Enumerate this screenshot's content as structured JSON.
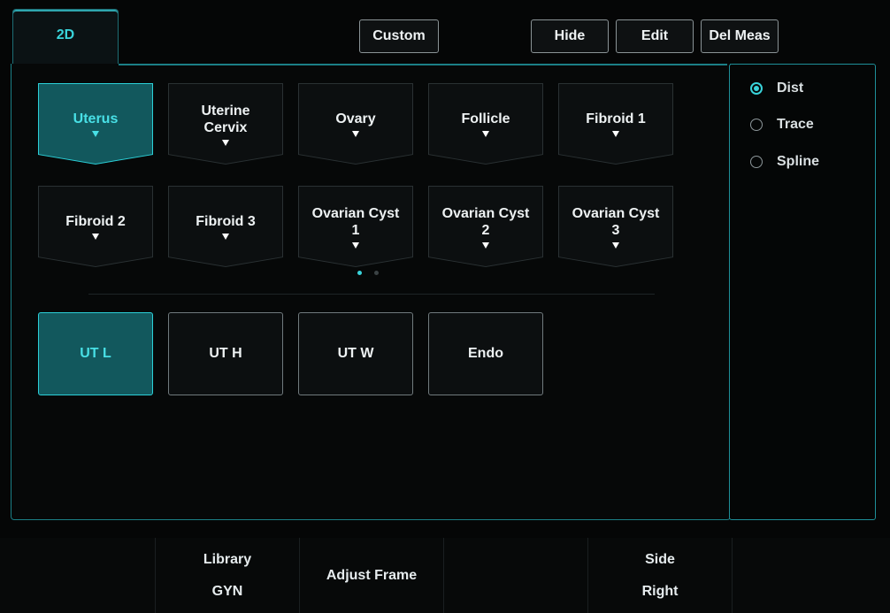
{
  "tab": {
    "label": "2D"
  },
  "toolbar": {
    "custom_label": "Custom",
    "hide_label": "Hide",
    "edit_label": "Edit",
    "del_meas_label": "Del Meas"
  },
  "structures": [
    {
      "label": "Uterus",
      "selected": true
    },
    {
      "label": "Uterine\nCervix",
      "selected": false
    },
    {
      "label": "Ovary",
      "selected": false
    },
    {
      "label": "Follicle",
      "selected": false
    },
    {
      "label": "Fibroid 1",
      "selected": false
    },
    {
      "label": "Fibroid 2",
      "selected": false
    },
    {
      "label": "Fibroid 3",
      "selected": false
    },
    {
      "label": "Ovarian Cyst\n1",
      "selected": false
    },
    {
      "label": "Ovarian Cyst\n2",
      "selected": false
    },
    {
      "label": "Ovarian Cyst\n3",
      "selected": false
    }
  ],
  "pager": {
    "pages": 2,
    "current": 1
  },
  "measurements": [
    {
      "label": "UT L",
      "selected": true
    },
    {
      "label": "UT H",
      "selected": false
    },
    {
      "label": "UT W",
      "selected": false
    },
    {
      "label": "Endo",
      "selected": false
    }
  ],
  "methods": [
    {
      "label": "Dist",
      "selected": true
    },
    {
      "label": "Trace",
      "selected": false
    },
    {
      "label": "Spline",
      "selected": false
    }
  ],
  "bottom": {
    "library_label": "Library",
    "library_value": "GYN",
    "adjust_frame_label": "Adjust Frame",
    "side_label": "Side",
    "side_value": "Right"
  },
  "colors": {
    "accent": "#39d3da",
    "selected_fill": "#12585d",
    "background": "#050606"
  }
}
